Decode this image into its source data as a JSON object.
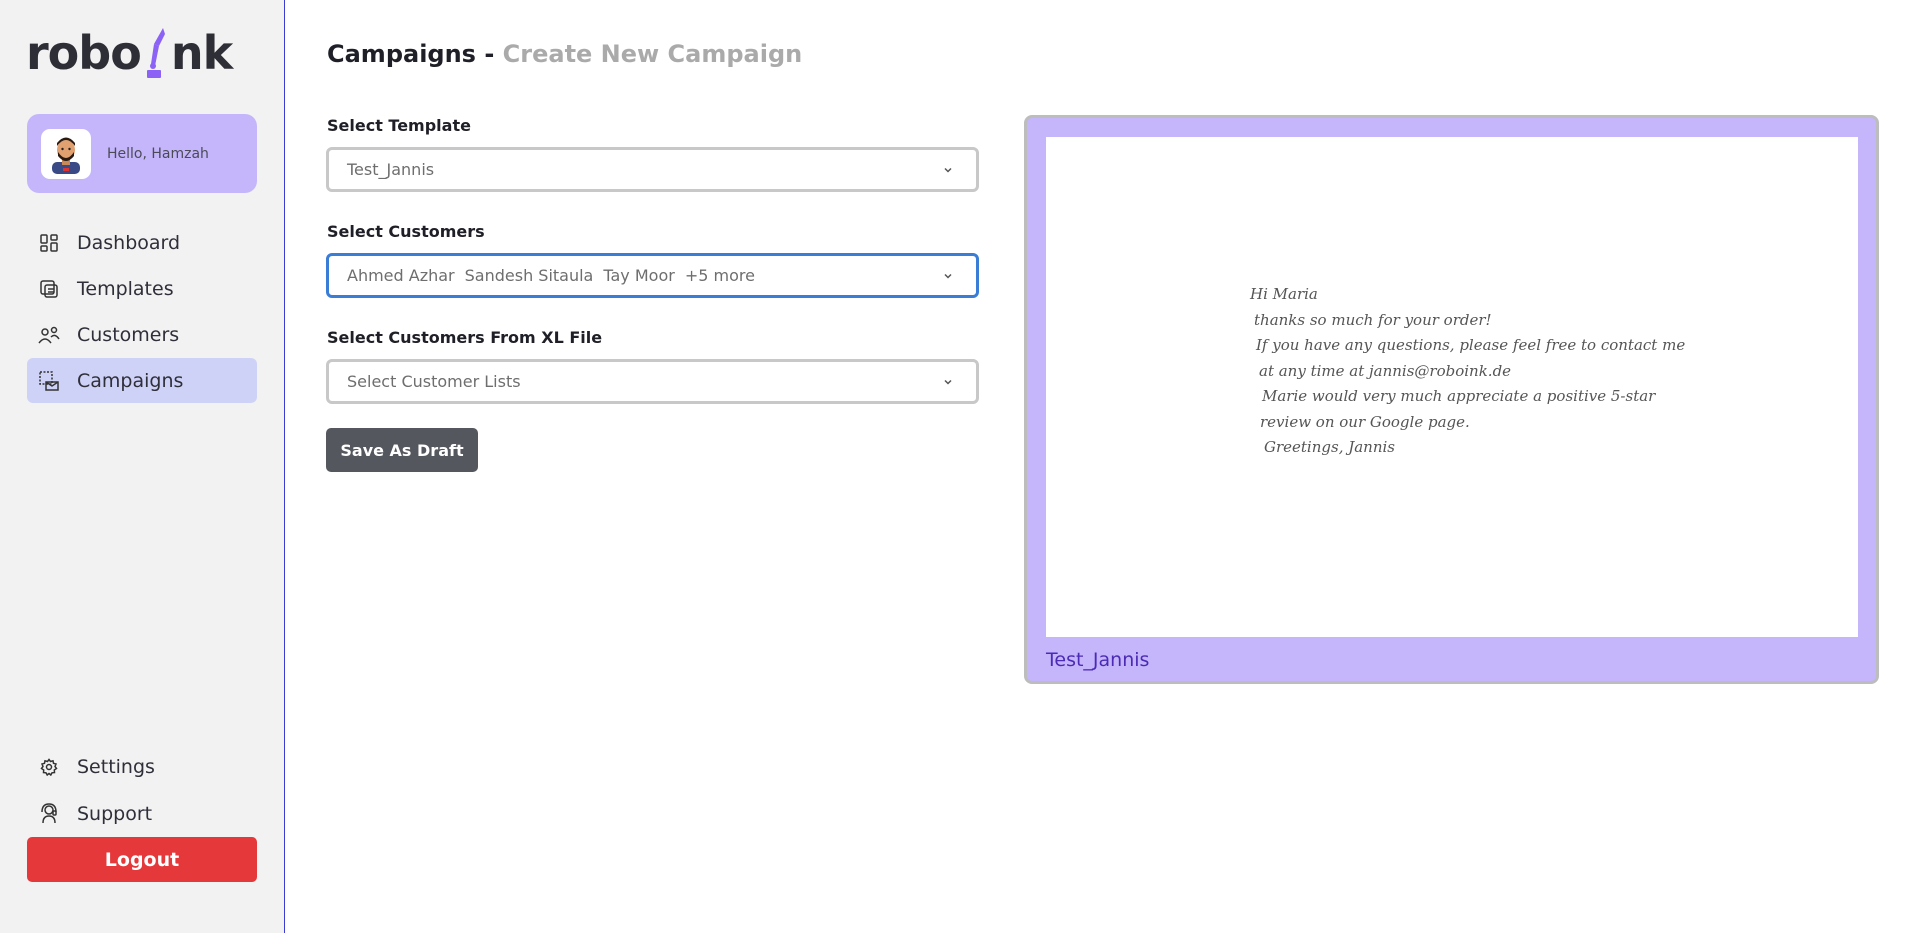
{
  "brand": {
    "logo_text_a": "robo",
    "logo_text_b": "nk"
  },
  "user": {
    "greeting": "Hello, Hamzah"
  },
  "sidebar": {
    "items": [
      {
        "label": "Dashboard",
        "icon": "dashboard-icon"
      },
      {
        "label": "Templates",
        "icon": "templates-icon"
      },
      {
        "label": "Customers",
        "icon": "customers-icon"
      },
      {
        "label": "Campaigns",
        "icon": "campaigns-icon",
        "active": true
      }
    ],
    "bottom": [
      {
        "label": "Settings",
        "icon": "gear-icon"
      },
      {
        "label": "Support",
        "icon": "support-icon"
      }
    ],
    "logout_label": "Logout"
  },
  "header": {
    "title": "Campaigns - ",
    "subtitle": "Create New Campaign"
  },
  "form": {
    "template": {
      "label": "Select Template",
      "value": "Test_Jannis"
    },
    "customers": {
      "label": "Select Customers",
      "chips": [
        "Ahmed Azhar",
        "Sandesh Sitaula",
        "Tay Moor",
        "+5 more"
      ]
    },
    "xl_file": {
      "label": "Select Customers From XL File",
      "placeholder": "Select Customer Lists"
    },
    "draft_label": "Save As Draft"
  },
  "preview": {
    "lines": [
      "Hi Maria",
      "thanks so much for your order!",
      "If you have any questions, please feel free to contact me",
      "at any time at jannis@roboink.de",
      "Marie would very much appreciate a positive 5-star",
      "review on our Google page.",
      "Greetings, Jannis"
    ],
    "name": "Test_Jannis"
  },
  "colors": {
    "accent": "#c5b6fb",
    "active_nav": "#cfd2f7",
    "logout": "#e5383b",
    "focus": "#3a7dd6"
  }
}
